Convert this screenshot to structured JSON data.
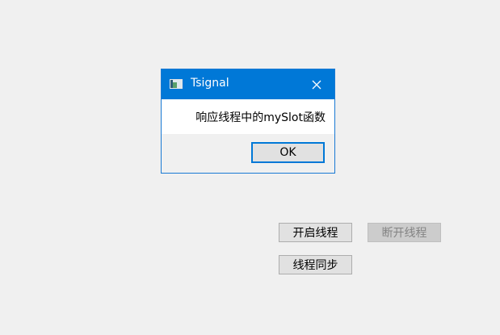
{
  "buttons": {
    "start_thread": "开启线程",
    "stop_thread": "断开线程",
    "sync_thread": "线程同步"
  },
  "dialog": {
    "title": "Tsignal",
    "icon": "window-icon",
    "close_icon": "close-icon",
    "message": "响应线程中的mySlot函数",
    "ok_label": "OK"
  },
  "colors": {
    "titlebar": "#0078d7",
    "background": "#f0f0f0",
    "button_face": "#e1e1e1"
  }
}
